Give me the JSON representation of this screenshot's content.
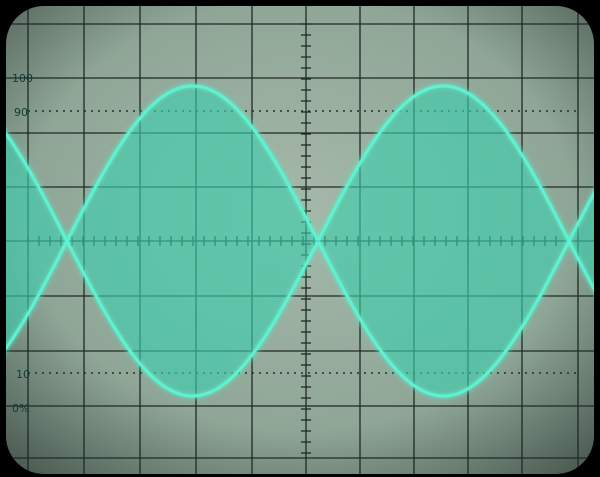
{
  "scale_labels": {
    "top_100": "100",
    "top_90": "90",
    "bottom_10": "10",
    "bottom_0": "0%"
  },
  "colors": {
    "screen_center": "#a6b8a9",
    "screen_edge": "#4d5e55",
    "graticule": "#1f2a25",
    "trace": "#39e8c2",
    "trace_glow": "#6ff5d6",
    "envelope_fill": "#36c7a6",
    "bezel": "#000000"
  },
  "signal": {
    "type": "amplitude-modulated sine",
    "modulation_percent": 100,
    "visible_modulation_cycles": 2.3
  }
}
